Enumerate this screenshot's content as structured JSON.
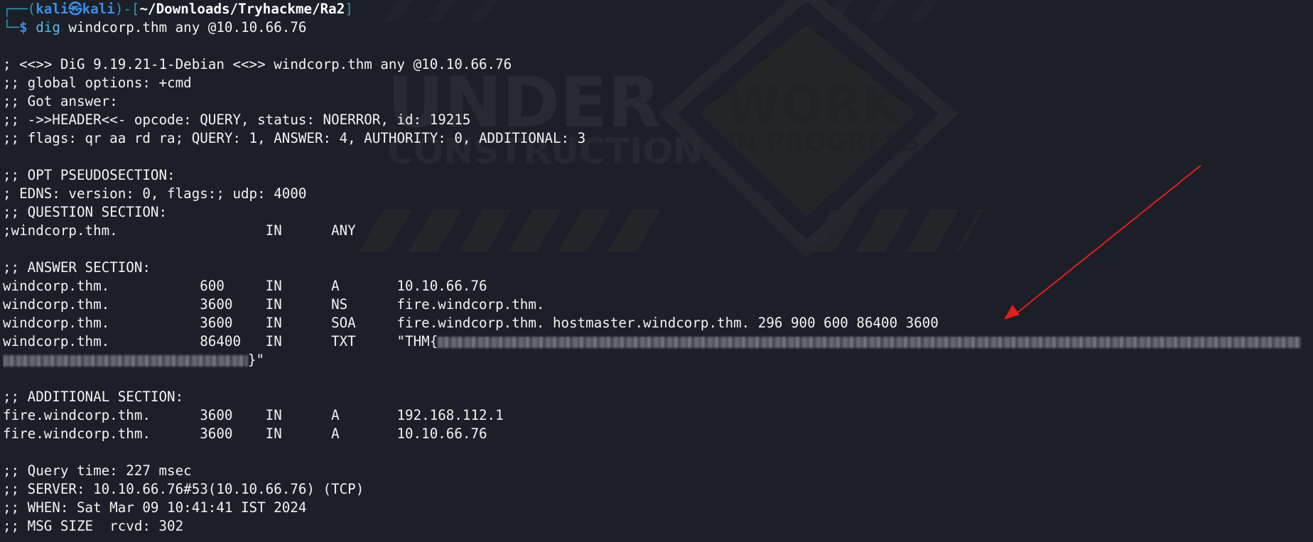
{
  "prompt": {
    "box_top": "┌──(",
    "user_host": "kali㉿kali",
    "bracket_mid": ")-[",
    "cwd": "~/Downloads/Tryhackme/Ra2",
    "bracket_end": "]",
    "box_bottom": "└─",
    "dollar": "$ ",
    "command": "dig",
    "args": " windcorp.thm any @10.10.66.76"
  },
  "output": {
    "l01": "; <<>> DiG 9.19.21-1-Debian <<>> windcorp.thm any @10.10.66.76",
    "l02": ";; global options: +cmd",
    "l03": ";; Got answer:",
    "l04": ";; ->>HEADER<<- opcode: QUERY, status: NOERROR, id: 19215",
    "l05": ";; flags: qr aa rd ra; QUERY: 1, ANSWER: 4, AUTHORITY: 0, ADDITIONAL: 3",
    "l06": ";; OPT PSEUDOSECTION:",
    "l07": "; EDNS: version: 0, flags:; udp: 4000",
    "l08": ";; QUESTION SECTION:",
    "l09": ";windcorp.thm.                  IN      ANY",
    "l10": ";; ANSWER SECTION:",
    "l11": "windcorp.thm.           600     IN      A       10.10.66.76",
    "l12": "windcorp.thm.           3600    IN      NS      fire.windcorp.thm.",
    "l13": "windcorp.thm.           3600    IN      SOA     fire.windcorp.thm. hostmaster.windcorp.thm. 296 900 600 86400 3600",
    "l14_prefix": "windcorp.thm.           86400   IN      TXT     \"THM{",
    "l15_suffix": "}\"",
    "l16": ";; ADDITIONAL SECTION:",
    "l17": "fire.windcorp.thm.      3600    IN      A       192.168.112.1",
    "l18": "fire.windcorp.thm.      3600    IN      A       10.10.66.76",
    "l19": ";; Query time: 227 msec",
    "l20": ";; SERVER: 10.10.66.76#53(10.10.66.76) (TCP)",
    "l21": ";; WHEN: Sat Mar 09 10:41:41 IST 2024",
    "l22": ";; MSG SIZE  rcvd: 302"
  },
  "wallpaper": {
    "text_under": "UNDER",
    "text_construction": "CONSTRUCTION",
    "text_work": "WORK",
    "text_in_progress": "IN PROGRESS"
  },
  "colors": {
    "background": "#1c1f28",
    "prompt_accent": "#3a8ee6",
    "annotation_arrow": "#e0201e"
  }
}
